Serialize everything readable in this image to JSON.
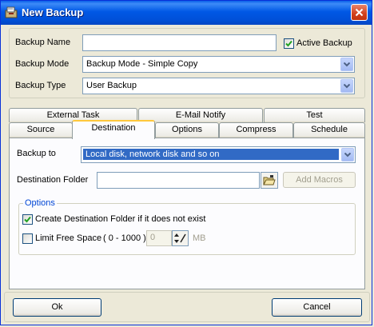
{
  "window": {
    "title": "New Backup"
  },
  "general": {
    "backup_name_label": "Backup Name",
    "backup_name_value": "",
    "active_backup_label": "Active Backup",
    "active_backup_checked": true,
    "backup_mode_label": "Backup Mode",
    "backup_mode_value": "Backup Mode - Simple Copy",
    "backup_type_label": "Backup Type",
    "backup_type_value": "User Backup"
  },
  "tabs": {
    "row_back": [
      "External Task",
      "E-Mail Notify",
      "Test"
    ],
    "row_front": [
      "Source",
      "Destination",
      "Options",
      "Compress",
      "Schedule"
    ],
    "active": "Destination"
  },
  "destination": {
    "backup_to_label": "Backup to",
    "backup_to_value": "Local disk, network disk and so on",
    "dest_folder_label": "Destination Folder",
    "dest_folder_value": "",
    "add_macros_label": "Add Macros",
    "options_legend": "Options",
    "create_folder_label": "Create Destination Folder if it does not exist",
    "create_folder_checked": true,
    "limit_free_space_label": "Limit Free Space",
    "limit_range": "( 0 - 1000 )",
    "limit_value": "0",
    "limit_unit": "MB"
  },
  "footer": {
    "ok_label": "Ok",
    "cancel_label": "Cancel"
  },
  "icons": {
    "app": "backup-app-icon",
    "close": "close-icon",
    "folder": "open-folder-icon",
    "spinner": "spinner-icon",
    "dropdown": "chevron-down-icon",
    "check": "check-icon"
  }
}
